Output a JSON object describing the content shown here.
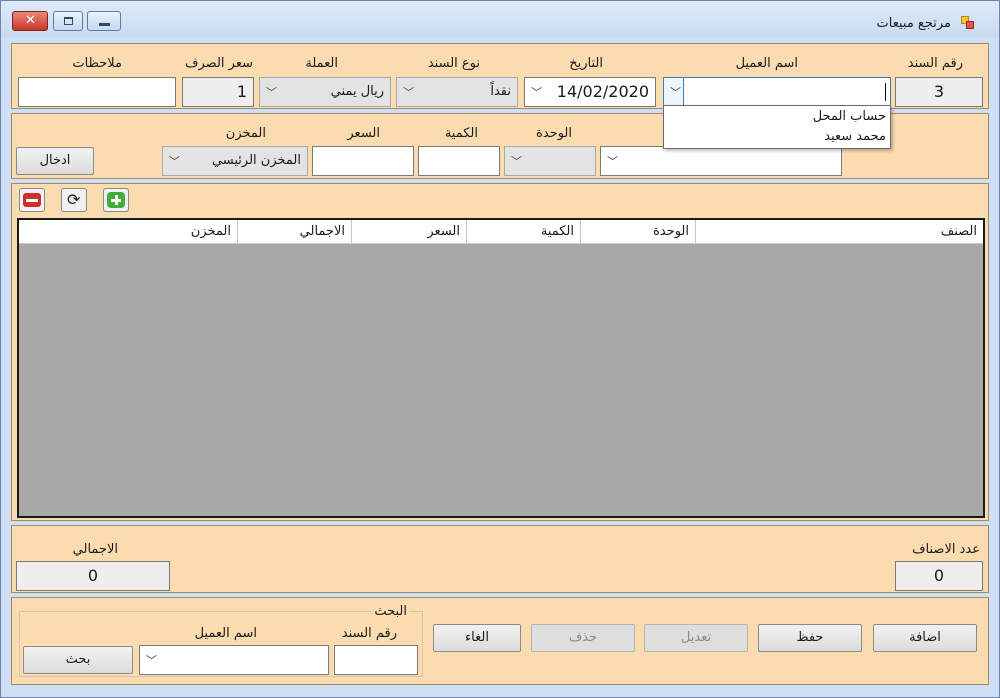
{
  "window": {
    "title": "مرتجع مبيعات",
    "controls": {
      "close": "close",
      "maximize": "maximize",
      "minimize": "minimize"
    }
  },
  "header": {
    "doc_number_label": "رقم السند",
    "doc_number_value": "3",
    "customer_label": "اسم العميل",
    "customer_value": "",
    "date_label": "التاريخ",
    "date_value": "14/02/2020",
    "doc_type_label": "نوع السند",
    "doc_type_value": "نقداً",
    "currency_label": "العملة",
    "currency_value": "ريال يمني",
    "exchange_rate_label": "سعر الصرف",
    "exchange_rate_value": "1",
    "notes_label": "ملاحظات",
    "notes_value": ""
  },
  "customer_dropdown": {
    "options": [
      "حساب المحل",
      "محمد سعيد"
    ]
  },
  "item_entry": {
    "unit_label": "الوحدة",
    "quantity_label": "الكمية",
    "price_label": "السعر",
    "store_label": "المخزن",
    "store_value": "المخزن الرئيسي",
    "enter_button": "ادخال"
  },
  "toolbar": {
    "delete_icon": "delete-row-icon",
    "refresh_icon": "refresh-icon",
    "add_icon": "add-row-icon"
  },
  "grid": {
    "columns": [
      "الصنف",
      "الوحدة",
      "الكمية",
      "السعر",
      "الاجمالي",
      "المخزن"
    ],
    "rows": []
  },
  "footer": {
    "items_count_label": "عدد الاصناف",
    "items_count_value": "0",
    "total_label": "الاجمالي",
    "total_value": "0"
  },
  "actions": {
    "add": "اضافة",
    "save": "حفظ",
    "edit": "تعديل",
    "delete": "حذف",
    "cancel": "الغاء"
  },
  "search": {
    "group_title": "البحث",
    "doc_number_label": "رقم السند",
    "doc_number_value": "",
    "customer_label": "اسم العميل",
    "customer_value": "",
    "search_button": "بحث"
  },
  "colors": {
    "panel_bg": "#fbdcb0",
    "window_bg": "#cfe0f5",
    "grid_bg": "#a9a9a9"
  }
}
